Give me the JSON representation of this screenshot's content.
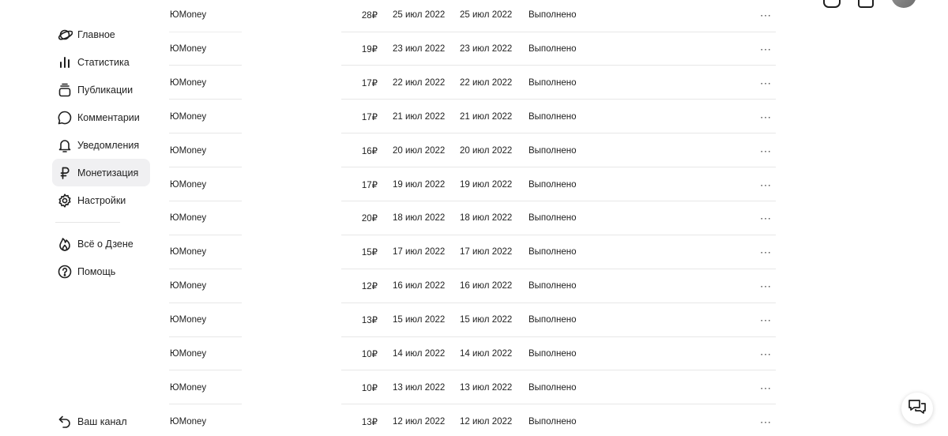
{
  "sidebar": {
    "items": [
      {
        "label": "Главное",
        "icon": "planet-icon",
        "active": false
      },
      {
        "label": "Статистика",
        "icon": "bar-chart-icon",
        "active": false
      },
      {
        "label": "Публикации",
        "icon": "stack-icon",
        "active": false
      },
      {
        "label": "Комментарии",
        "icon": "comment-icon",
        "active": false
      },
      {
        "label": "Уведомления",
        "icon": "bell-icon",
        "active": false
      },
      {
        "label": "Монетизация",
        "icon": "ruble-icon",
        "active": true
      },
      {
        "label": "Настройки",
        "icon": "gear-icon",
        "active": false
      }
    ],
    "secondary": [
      {
        "label": "Всё о Дзене",
        "icon": "flame-icon"
      },
      {
        "label": "Помощь",
        "icon": "help-icon"
      }
    ],
    "channel_label": "Ваш канал"
  },
  "payouts": {
    "rows": [
      {
        "method": "ЮMoney",
        "amount": "28₽",
        "created": "25 июл 2022",
        "paid": "25 июл 2022",
        "status": "Выполнено"
      },
      {
        "method": "ЮMoney",
        "amount": "19₽",
        "created": "23 июл 2022",
        "paid": "23 июл 2022",
        "status": "Выполнено"
      },
      {
        "method": "ЮMoney",
        "amount": "17₽",
        "created": "22 июл 2022",
        "paid": "22 июл 2022",
        "status": "Выполнено"
      },
      {
        "method": "ЮMoney",
        "amount": "17₽",
        "created": "21 июл 2022",
        "paid": "21 июл 2022",
        "status": "Выполнено"
      },
      {
        "method": "ЮMoney",
        "amount": "16₽",
        "created": "20 июл 2022",
        "paid": "20 июл 2022",
        "status": "Выполнено"
      },
      {
        "method": "ЮMoney",
        "amount": "17₽",
        "created": "19 июл 2022",
        "paid": "19 июл 2022",
        "status": "Выполнено"
      },
      {
        "method": "ЮMoney",
        "amount": "20₽",
        "created": "18 июл 2022",
        "paid": "18 июл 2022",
        "status": "Выполнено"
      },
      {
        "method": "ЮMoney",
        "amount": "15₽",
        "created": "17 июл 2022",
        "paid": "17 июл 2022",
        "status": "Выполнено"
      },
      {
        "method": "ЮMoney",
        "amount": "12₽",
        "created": "16 июл 2022",
        "paid": "16 июл 2022",
        "status": "Выполнено"
      },
      {
        "method": "ЮMoney",
        "amount": "13₽",
        "created": "15 июл 2022",
        "paid": "15 июл 2022",
        "status": "Выполнено"
      },
      {
        "method": "ЮMoney",
        "amount": "10₽",
        "created": "14 июл 2022",
        "paid": "14 июл 2022",
        "status": "Выполнено"
      },
      {
        "method": "ЮMoney",
        "amount": "10₽",
        "created": "13 июл 2022",
        "paid": "13 июл 2022",
        "status": "Выполнено"
      },
      {
        "method": "ЮMoney",
        "amount": "13₽",
        "created": "12 июл 2022",
        "paid": "12 июл 2022",
        "status": "Выполнено"
      }
    ],
    "more_glyph": "···"
  },
  "colors": {
    "active_bg": "#f0f0f2",
    "divider": "#e7e7e7",
    "text": "#1f1f1f"
  }
}
